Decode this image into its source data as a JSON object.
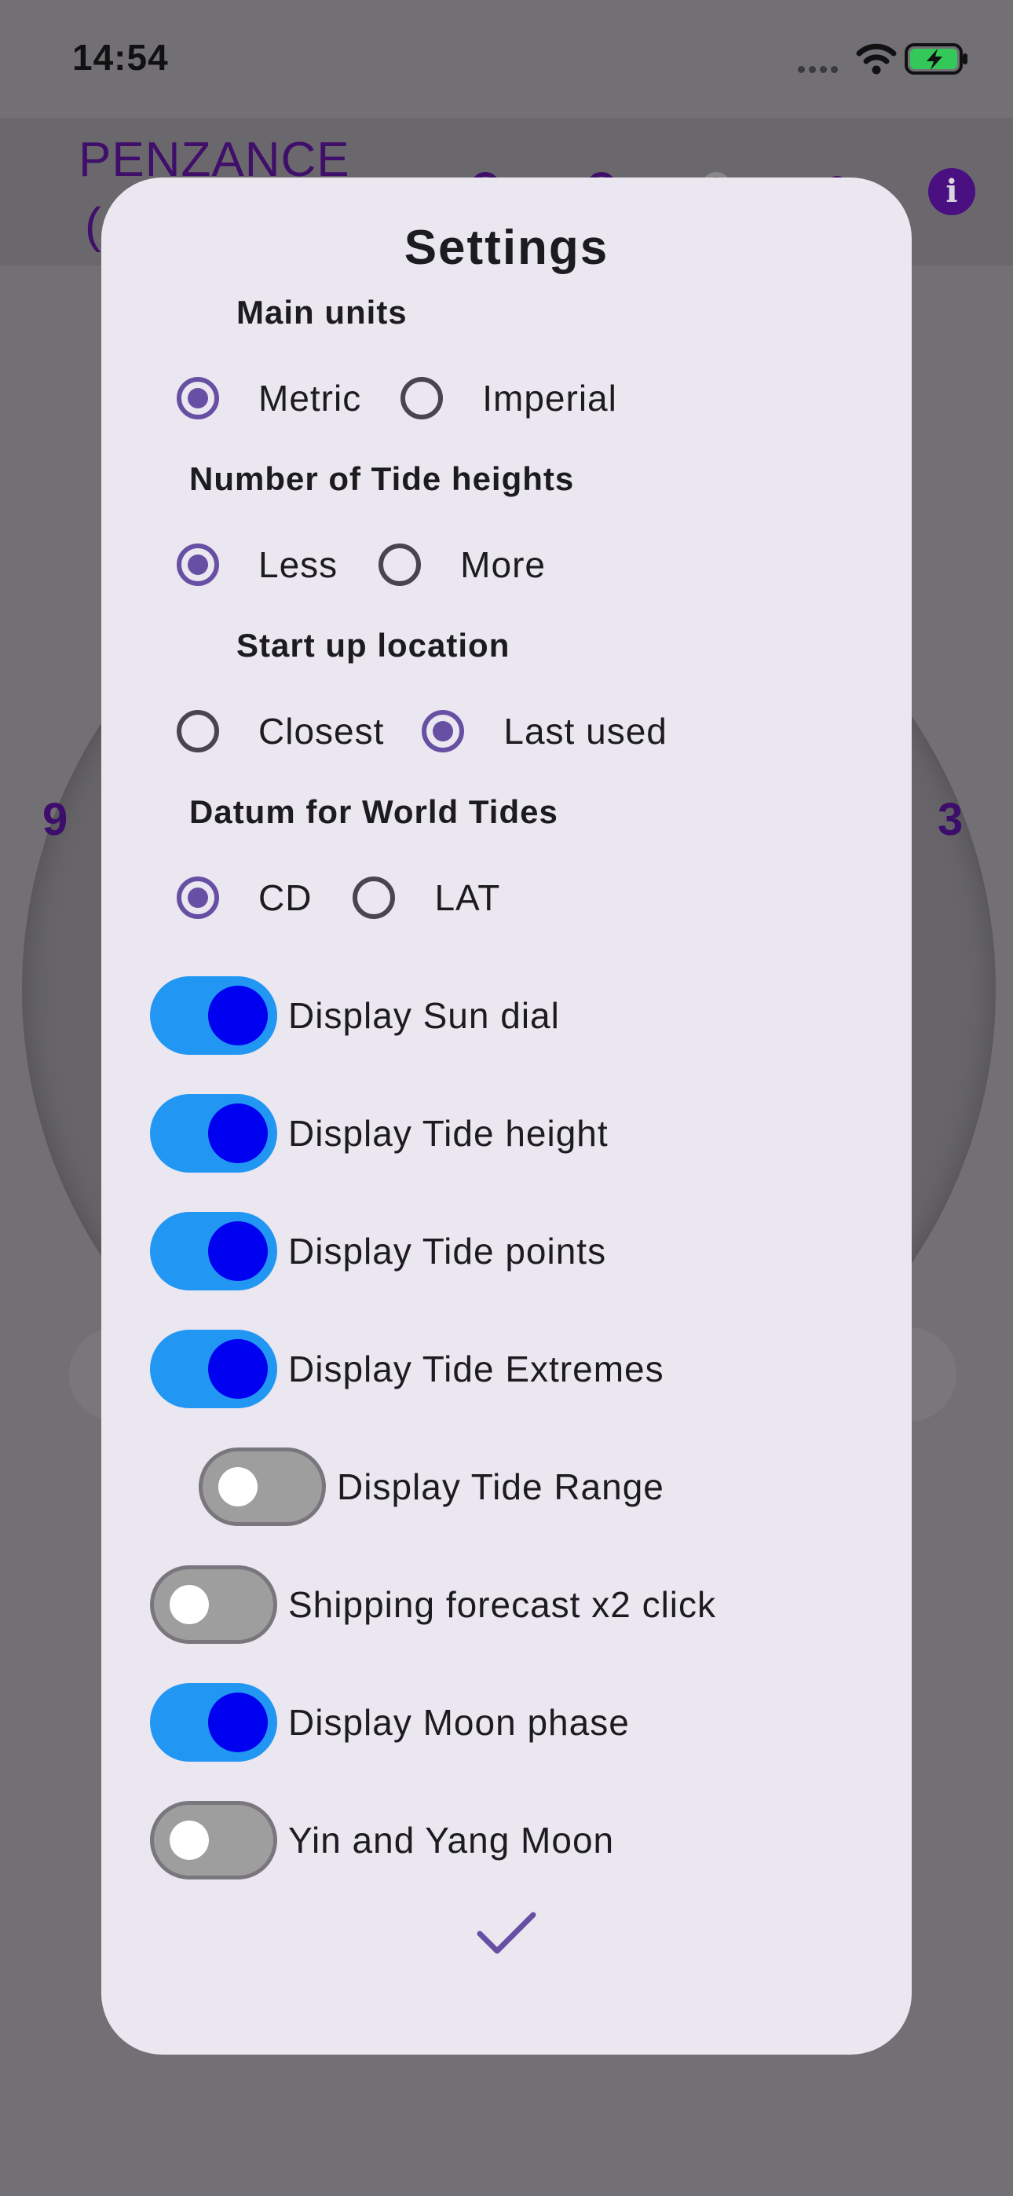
{
  "status_bar": {
    "time": "14:54"
  },
  "background": {
    "location_title": "PENZANCE",
    "location_paren": "(",
    "dial_left": "9",
    "dial_right": "3"
  },
  "dialog": {
    "title": "Settings",
    "sections": [
      {
        "title": "Main units",
        "options": [
          "Metric",
          "Imperial"
        ],
        "selected": "Metric"
      },
      {
        "title": "Number of Tide heights",
        "options": [
          "Less",
          "More"
        ],
        "selected": "Less"
      },
      {
        "title": "Start up location",
        "options": [
          "Closest",
          "Last used"
        ],
        "selected": "Last used"
      },
      {
        "title": "Datum for World Tides",
        "options": [
          "CD",
          "LAT"
        ],
        "selected": "CD"
      }
    ],
    "toggles": [
      {
        "label": "Display Sun dial",
        "on": true
      },
      {
        "label": "Display Tide height",
        "on": true
      },
      {
        "label": "Display Tide points",
        "on": true
      },
      {
        "label": "Display Tide Extremes",
        "on": true
      },
      {
        "label": "Display Tide Range",
        "on": false
      },
      {
        "label": "Shipping forecast x2 click",
        "on": false
      },
      {
        "label": "Display Moon phase",
        "on": true
      },
      {
        "label": "Yin and Yang Moon",
        "on": false
      }
    ]
  },
  "colors": {
    "accent": "#6750a4",
    "switch_on_track": "#2196f3",
    "switch_on_knob": "#0000f0",
    "switch_off_track": "#9e9e9e",
    "title_purple": "#3f0f6a"
  }
}
